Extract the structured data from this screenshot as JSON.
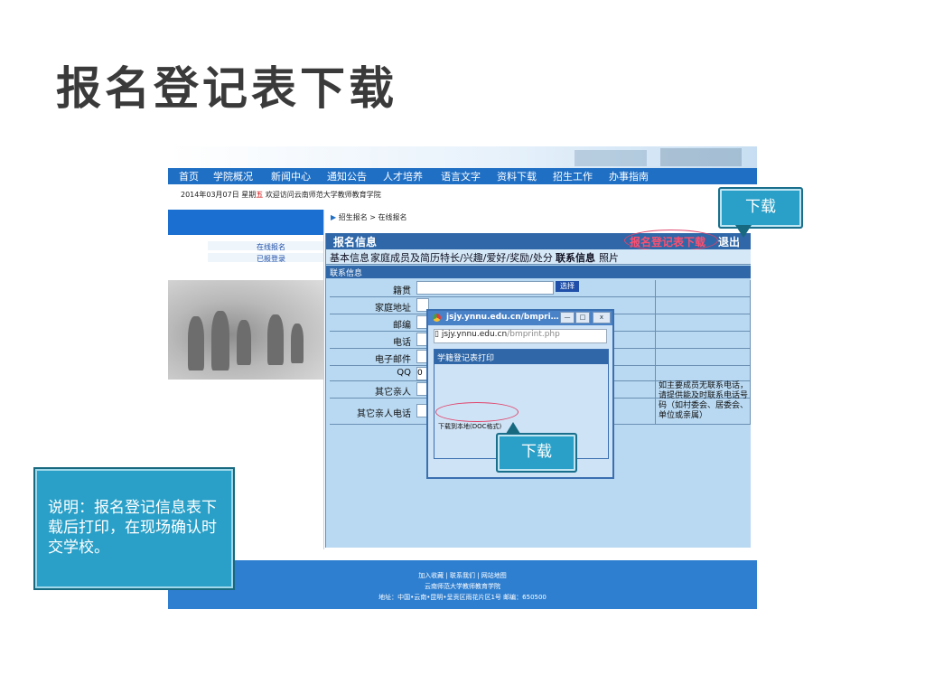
{
  "slide": {
    "title": "报名登记表下载"
  },
  "nav": {
    "items": [
      "首页",
      "学院概况",
      "新闻中心",
      "通知公告",
      "人才培养",
      "语言文字",
      "资料下载",
      "招生工作",
      "办事指南"
    ]
  },
  "date_line": {
    "prefix": "2014年03月07日 星期",
    "weekday": "五",
    "welcome": "欢迎访问云南师范大学教师教育学院"
  },
  "left": {
    "links": [
      "在线报名",
      "已报登录"
    ]
  },
  "breadcrumb": "招生报名 > 在线报名",
  "panel": {
    "title": "报名信息",
    "download": "报名登记表下载",
    "exit": "退出",
    "section": "联系信息"
  },
  "tabs": [
    "基本信息",
    "家庭成员及简历",
    "特长/兴趣/爱好/奖励/处分",
    "联系信息",
    "照片"
  ],
  "form": {
    "rows": [
      {
        "label": "籍贯",
        "value": ""
      },
      {
        "label": "家庭地址",
        "value": ""
      },
      {
        "label": "邮编",
        "value": ""
      },
      {
        "label": "电话",
        "value": ""
      },
      {
        "label": "电子邮件",
        "value": ""
      },
      {
        "label": "QQ",
        "value": "0"
      },
      {
        "label": "其它亲人",
        "value": ""
      },
      {
        "label": "其它亲人电话",
        "value": ""
      }
    ],
    "select_button": "选择",
    "note": "如主要成员无联系电话，请提供能及时联系电话号码（如村委会、居委会、单位或亲属）"
  },
  "popup": {
    "title": "jsjy.ynnu.edu.cn/bmpri…",
    "url_host": "jsjy.ynnu.edu.cn",
    "url_path": "/bmprint.php",
    "inner_title": "学籍登记表打印",
    "download_local": "下载到本地(DOC格式)"
  },
  "footer": {
    "links": "加入收藏 | 联系我们 | 网站地图",
    "org": "云南师范大学教师教育学院",
    "address": "地址：中国•云南•昆明•呈贡区雨花片区1号 邮编：650500"
  },
  "callouts": {
    "top": "下载",
    "popup": "下载"
  },
  "note": "说明：报名登记信息表下载后打印，在现场确认时交学校。",
  "colors": {
    "accent": "#2aa0c8",
    "nav": "#1f6fc4",
    "panel": "#2f67a8",
    "highlight": "#e0436a"
  }
}
